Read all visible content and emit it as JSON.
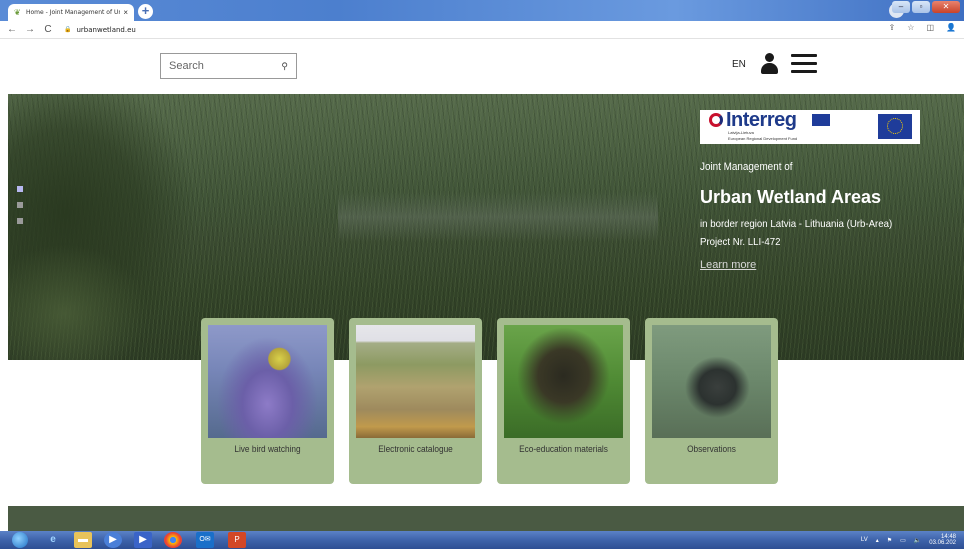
{
  "browser": {
    "tab_title": "Home - Joint Management of Ur",
    "tab_close": "×",
    "new_tab": "+",
    "url": "urbanwetland.eu",
    "back": "←",
    "forward": "→",
    "reload": "C",
    "lock": "🔒"
  },
  "header": {
    "search_placeholder": "Search",
    "language": "EN"
  },
  "hero": {
    "logo_text": "Interreg",
    "logo_sub1": "Latvija-Lietuva",
    "logo_sub2": "European Regional Development Fund",
    "subtitle": "Joint Management of",
    "title": "Urban Wetland Areas",
    "description": "in border region Latvia - Lithuania (Urb-Area) Project Nr. LLI-472",
    "link": "Learn more",
    "slides": 3,
    "active_slide": 1
  },
  "cards": [
    {
      "label": "Live bird watching"
    },
    {
      "label": "Electronic catalogue"
    },
    {
      "label": "Eco-education materials"
    },
    {
      "label": "Observations"
    }
  ],
  "taskbar": {
    "lang": "LV",
    "time": "14:48",
    "date": "03.06.202"
  },
  "colors": {
    "card_bg": "#a5bc8e",
    "footer_band": "#4a5a43",
    "active_dot": "#b7b8f0"
  }
}
